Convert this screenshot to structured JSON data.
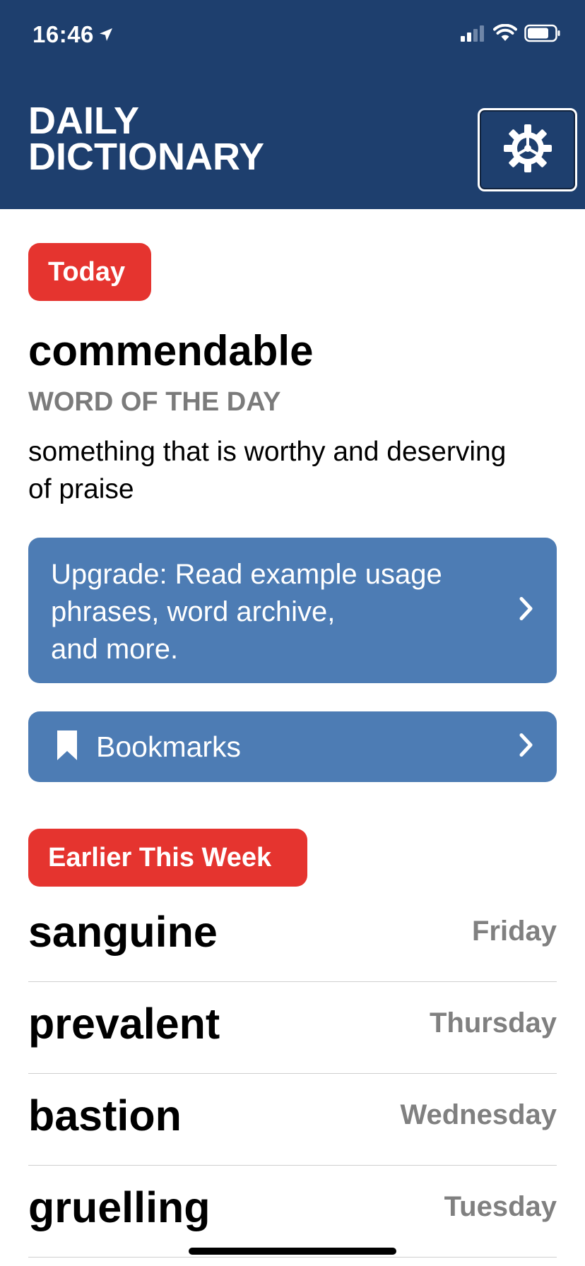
{
  "status_bar": {
    "time": "16:46",
    "location_icon": "location-arrow-icon",
    "signal_icon": "cellular-signal-icon",
    "wifi_icon": "wifi-icon",
    "battery_icon": "battery-icon"
  },
  "header": {
    "title": "DAILY\nDICTIONARY",
    "settings_icon": "gear-icon",
    "background_color": "#1e3f6e"
  },
  "today": {
    "badge": "Today",
    "word": "commendable",
    "subtitle": "WORD OF THE DAY",
    "definition": "something that is worthy and deserving of praise"
  },
  "upgrade": {
    "text": "Upgrade: Read example usage\nphrases, word archive,\nand more.",
    "chevron_icon": "chevron-right-icon"
  },
  "bookmarks": {
    "label": "Bookmarks",
    "icon": "bookmark-icon",
    "chevron_icon": "chevron-right-icon"
  },
  "earlier": {
    "badge": "Earlier This Week",
    "items": [
      {
        "word": "sanguine",
        "day": "Friday"
      },
      {
        "word": "prevalent",
        "day": "Thursday"
      },
      {
        "word": "bastion",
        "day": "Wednesday"
      },
      {
        "word": "gruelling",
        "day": "Tuesday"
      }
    ]
  },
  "colors": {
    "badge_red": "#e5342f",
    "card_blue": "#4d7cb4",
    "subtitle_gray": "#7b7b7b"
  }
}
